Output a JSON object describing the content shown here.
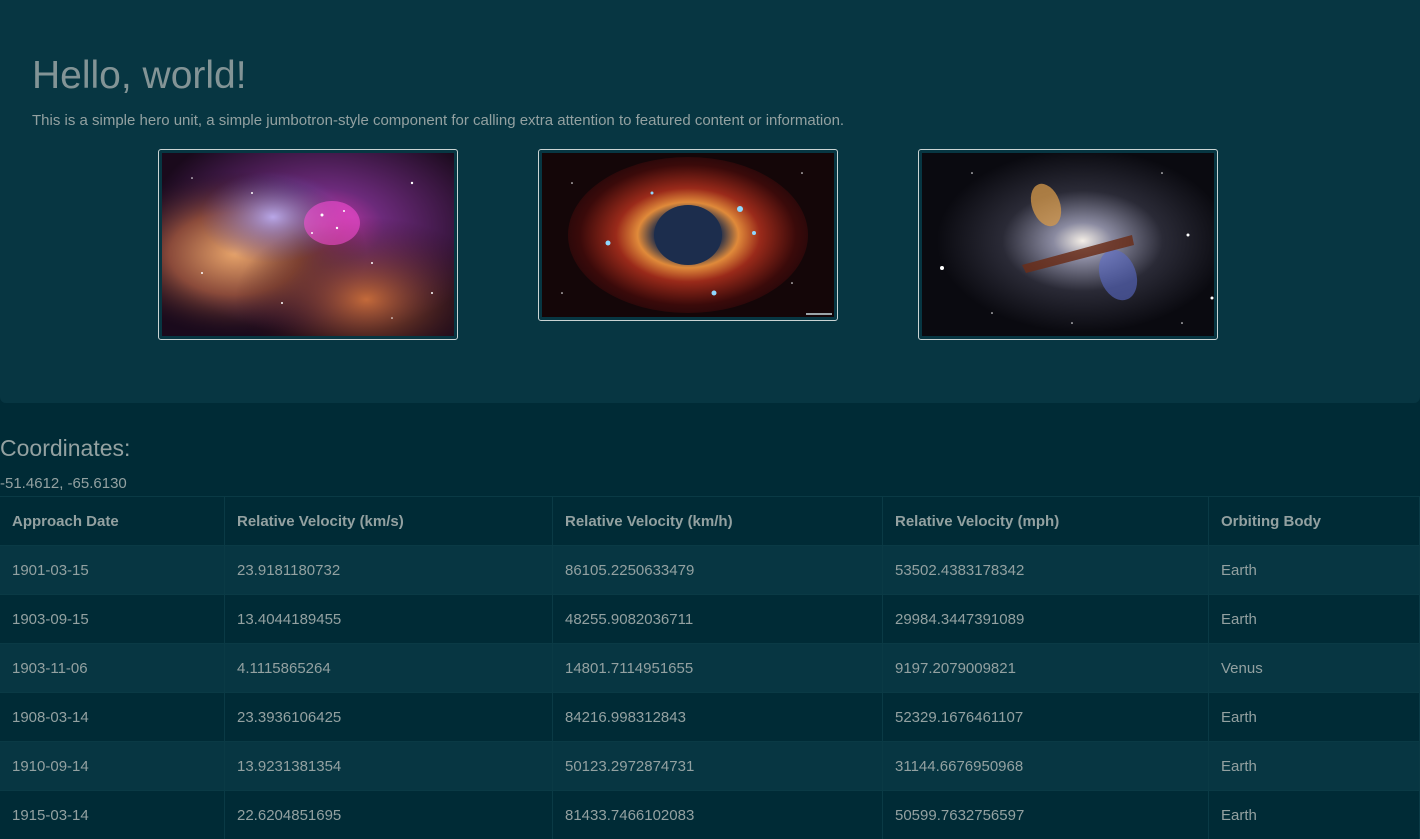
{
  "hero": {
    "title": "Hello, world!",
    "description": "This is a simple hero unit, a simple jumbotron-style component for calling extra attention to featured content or information."
  },
  "images": [
    {
      "subject": "star-forming-nebula"
    },
    {
      "subject": "helix-nebula"
    },
    {
      "subject": "galaxy-with-jets"
    }
  ],
  "coordinates": {
    "label": "Coordinates:",
    "value": "-51.4612, -65.6130"
  },
  "table": {
    "headers": [
      "Approach Date",
      "Relative Velocity (km/s)",
      "Relative Velocity (km/h)",
      "Relative Velocity (mph)",
      "Orbiting Body"
    ],
    "rows": [
      [
        "1901-03-15",
        "23.9181180732",
        "86105.2250633479",
        "53502.4383178342",
        "Earth"
      ],
      [
        "1903-09-15",
        "13.4044189455",
        "48255.9082036711",
        "29984.3447391089",
        "Earth"
      ],
      [
        "1903-11-06",
        "4.1115865264",
        "14801.7114951655",
        "9197.2079009821",
        "Venus"
      ],
      [
        "1908-03-14",
        "23.3936106425",
        "84216.998312843",
        "52329.1676461107",
        "Earth"
      ],
      [
        "1910-09-14",
        "13.9231381354",
        "50123.2972874731",
        "31144.6676950968",
        "Earth"
      ],
      [
        "1915-03-14",
        "22.6204851695",
        "81433.7466102083",
        "50599.7632756597",
        "Earth"
      ]
    ]
  }
}
